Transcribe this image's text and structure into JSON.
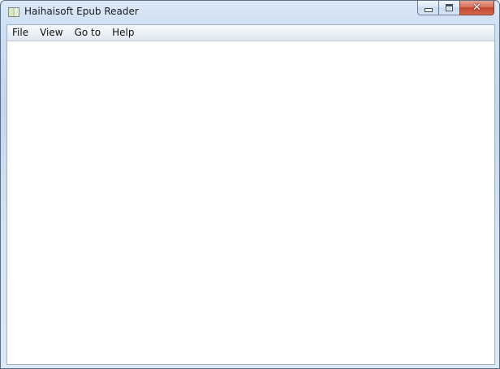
{
  "window": {
    "title": "Haihaisoft Epub Reader",
    "icon": "book-icon",
    "controls": {
      "minimize": "minimize-icon",
      "maximize": "maximize-icon",
      "close": "close-icon",
      "close_glyph": "✕"
    }
  },
  "menu": {
    "items": [
      {
        "label": "File"
      },
      {
        "label": "View"
      },
      {
        "label": "Go to"
      },
      {
        "label": "Help"
      }
    ]
  },
  "colors": {
    "close_button": "#c4432b",
    "frame": "#c3d6ec"
  }
}
